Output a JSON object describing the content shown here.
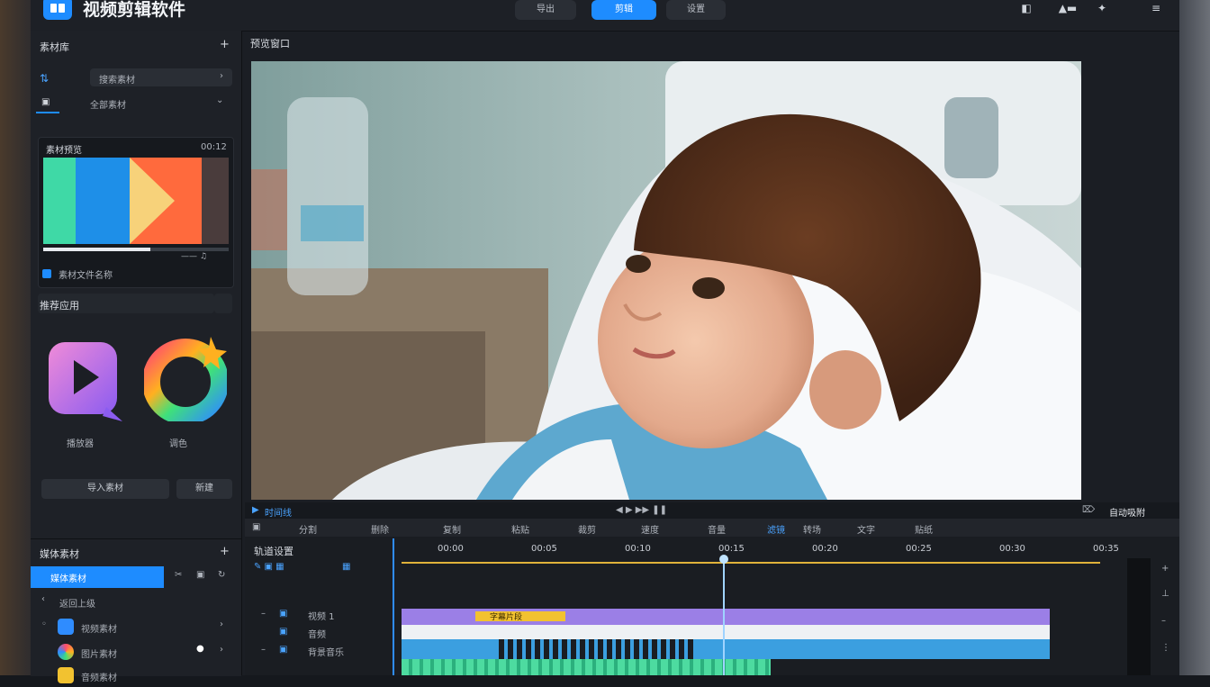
{
  "app": {
    "title": "视频剪辑软件",
    "header_buttons": [
      "导出",
      "剪辑",
      "设置"
    ]
  },
  "left_panel": {
    "header": "素材库",
    "search_tab_label": "搜索素材",
    "tab_label": "全部素材",
    "preview_card_title": "素材预览",
    "preview_card_time": "00:12",
    "preview_card_footer": "素材文件名称",
    "recommend_header": "推荐应用",
    "apps": [
      {
        "name": "播放器"
      },
      {
        "name": "调色"
      }
    ],
    "buttons": [
      "导入素材",
      "新建"
    ]
  },
  "media_panel": {
    "header": "媒体素材",
    "selected_item": "媒体素材",
    "back_item": "返回上级",
    "items": [
      "视频素材",
      "图片素材",
      "音频素材"
    ]
  },
  "preview": {
    "header": "预览窗口"
  },
  "timeline": {
    "toolbar_label": "时间线",
    "toolbar_right": "自动吸附",
    "track_header": "轨道设置",
    "subbar_labels": [
      "分割",
      "删除",
      "复制",
      "粘贴",
      "裁剪",
      "速度",
      "音量",
      "滤镜",
      "转场",
      "文字",
      "贴纸"
    ],
    "ruler": [
      "00:00",
      "00:05",
      "00:10",
      "00:15",
      "00:20",
      "00:25",
      "00:30",
      "00:35"
    ],
    "tracks": [
      "视频 1",
      "音频",
      "背景音乐"
    ],
    "clip_label": "字幕片段"
  },
  "colors": {
    "accent": "#1e8cff",
    "video_clip": "#9b7fe6",
    "title_clip": "#f2c230",
    "audio_clip": "#3b9fe0",
    "music_clip": "#4ddba0",
    "playhead": "#9fd3ff"
  },
  "icons": [
    "book-icon",
    "user-icon",
    "magic-wand-icon",
    "settings-sliders-icon",
    "plus-icon",
    "chevron-right-icon",
    "chevron-down-icon",
    "back-icon"
  ]
}
